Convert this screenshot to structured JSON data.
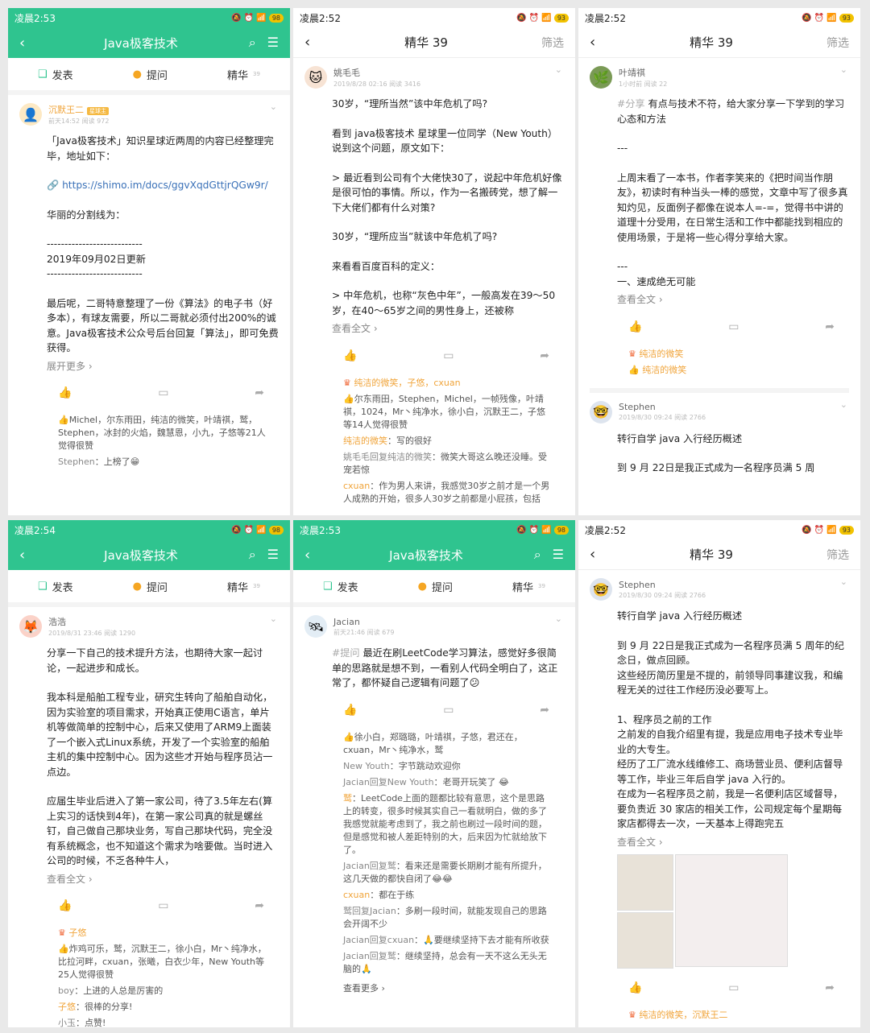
{
  "p1": {
    "time": "凌晨2:53",
    "battery": "98",
    "title": "Java极客技术",
    "tabs": [
      "发表",
      "提问",
      "精华"
    ],
    "tab_count": "39",
    "user": "沉默王二",
    "badge": "星球主",
    "meta": "前天14:52  阅读 972",
    "lines": [
      "「Java极客技术」知识星球近两周的内容已经整理完毕，地址如下：",
      "https://shimo.im/docs/ggvXqdGttjrQGw9r/",
      "华丽的分割线为：",
      "---------------------------\n2019年09月02日更新\n---------------------------",
      "最后呢，二哥特意整理了一份《算法》的电子书（好多本），有球友需要，所以二哥就必须付出200%的诚意。Java极客技术公众号后台回复「算法」，即可免费获得。"
    ],
    "more": "展开更多 ›",
    "likes": "Michel，尔东雨田，纯洁的微笑，叶靖祺，鹫，Stephen，冰封的火焰，魏慧恩，小九，子悠等21人觉得很赞",
    "comment_name": "Stephen",
    "comment_text": "上榜了😁"
  },
  "p2": {
    "time": "凌晨2:52",
    "battery": "93",
    "title": "精华 39",
    "filter": "筛选",
    "user": "姚毛毛",
    "meta": "2019/8/28 02:16  阅读 3416",
    "lines": [
      "30岁，“理所当然”该中年危机了吗?",
      "看到 java极客技术 星球里一位同学（New Youth）说到这个问题，原文如下：",
      "> 最近看到公司有个大佬快30了，说起中年危机好像是很可怕的事情。所以，作为一名搬砖党，想了解一下大佬们都有什么对策?",
      "30岁，“理所应当”就该中年危机了吗?",
      "来看看百度百科的定义：",
      "> 中年危机，也称“灰色中年”，一般高发在39～50岁，在40～65岁之间的男性身上，还被称"
    ],
    "more": "查看全文 ›",
    "reward": "纯洁的微笑，子悠，cxuan",
    "likes": "尔东雨田，Stephen，Michel，一帧残像，叶靖祺，1024，Mr丶纯净水，徐小白，沉默王二，子悠等14人觉得很赞",
    "comments": [
      {
        "name": "纯洁的微笑",
        "text": "：写的很好"
      },
      {
        "name": "姚毛毛回复纯洁的微笑",
        "text": "：微笑大哥这么晚还没睡。受宠若惊"
      },
      {
        "name": "cxuan",
        "text": "：作为男人来讲，我感觉30岁之前才是一个男人成熟的开始，很多人30岁之前都是小屁孩，包括"
      }
    ]
  },
  "p3": {
    "time": "凌晨2:52",
    "battery": "93",
    "title": "精华 39",
    "filter": "筛选",
    "user": "叶靖祺",
    "meta": "1小时前  阅读 22",
    "tag": "#分享",
    "first": "有点与技术不符，给大家分享一下学到的学习心态和方法",
    "lines": [
      "---",
      "上周末看了一本书，作者李笑来的《把时间当作朋友》，初读时有种当头一棒的感觉，文章中写了很多真知灼见，反面例子都像在说本人=-=，觉得书中讲的道理十分受用，在日常生活和工作中都能找到相应的使用场景，于是将一些心得分享给大家。",
      "---\n一、速成绝无可能"
    ],
    "more": "查看全文 ›",
    "reward": "纯洁的微笑",
    "likes": "纯洁的微笑",
    "user2": "Stephen",
    "meta2": "2019/8/30 09:24  阅读 2766",
    "line2": "转行自学 java 入行经历概述",
    "line3": "到 9 月 22日是我正式成为一名程序员满 5 周"
  },
  "p4": {
    "time": "凌晨2:54",
    "battery": "98",
    "title": "Java极客技术",
    "tabs": [
      "发表",
      "提问",
      "精华"
    ],
    "tab_count": "39",
    "user": "浩浩",
    "meta": "2019/8/31 23:46  阅读 1290",
    "lines": [
      "分享一下自己的技术提升方法，也期待大家一起讨论，一起进步和成长。",
      "我本科是船舶工程专业，研究生转向了船舶自动化，因为实验室的项目需求，开始真正使用C语言，单片机等做简单的控制中心，后来又使用了ARM9上面装了一个嵌入式Linux系统，开发了一个实验室的船舶主机的集中控制中心。因为这些才开始与程序员沾一点边。",
      "应届生毕业后进入了第一家公司，待了3.5年左右(算上实习的话快到4年)，在第一家公司真的就是螺丝钉，自己做自己那块业务，写自己那块代码，完全没有系统概念，也不知道这个需求为啥要做。当时进入公司的时候，不乏各种牛人，"
    ],
    "more": "查看全文 ›",
    "reward": "子悠",
    "likes": "炸鸡可乐，鹫，沉默王二，徐小白，Mr丶纯净水，比拉河畔，cxuan，张曦，白衣少年，New Youth等25人觉得很赞",
    "comments": [
      {
        "name": "boy",
        "text": "：上进的人总是厉害的"
      },
      {
        "name": "子悠",
        "text": "：很棒的分享!"
      },
      {
        "name": "小玉",
        "text": "：点赞!"
      }
    ]
  },
  "p5": {
    "time": "凌晨2:53",
    "battery": "98",
    "title": "Java极客技术",
    "tabs": [
      "发表",
      "提问",
      "精华"
    ],
    "tab_count": "39",
    "user": "Jacian",
    "meta": "前天21:46  阅读 679",
    "tag": "#提问",
    "first": "最近在刷LeetCode学习算法，感觉好多很简单的思路就是想不到，一看别人代码全明白了，这正常了，都怀疑自己逻辑有问题了😕",
    "likes": "徐小白，郑璐璐，叶靖祺，子悠，君还在，cxuan，Mr丶纯净水，鹫",
    "comments": [
      {
        "name": "New Youth",
        "text": "：字节跳动欢迎你"
      },
      {
        "name": "Jacian回复New Youth",
        "text": "：老哥开玩笑了 😂"
      },
      {
        "name": "鹫",
        "text": "：LeetCode上面的题都比较有意思，这个是思路上的转变，很多时候其实自己一看就明白，做的多了我感觉就能考虑到了，我之前也刷过一段时间的题，但是感觉和被人差距特别的大，后来因为忙就给放下了。"
      },
      {
        "name": "Jacian回复鹫",
        "text": "：看来还是需要长期刷才能有所提升，这几天做的都快自闭了😂😂"
      },
      {
        "name": "cxuan",
        "text": "：都在于练"
      },
      {
        "name": "鹫回复Jacian",
        "text": "：多刷一段时间，就能发现自己的思路会开阔不少"
      },
      {
        "name": "Jacian回复cxuan",
        "text": "：🙏要继续坚持下去才能有所收获"
      },
      {
        "name": "Jacian回复鹫",
        "text": "：继续坚持，总会有一天不这么无头无脑的🙏"
      }
    ],
    "more": "查看更多 ›"
  },
  "p6": {
    "time": "凌晨2:52",
    "battery": "93",
    "title": "精华 39",
    "filter": "筛选",
    "user": "Stephen",
    "meta": "2019/8/30 09:24  阅读 2766",
    "lines": [
      "转行自学 java 入行经历概述",
      "到 9 月 22日是我正式成为一名程序员满 5 周年的纪念日，做点回顾。\n这些经历简历里是不提的，前领导同事建议我，和编程无关的过往工作经历没必要写上。",
      "1、程序员之前的工作\n之前发的自我介绍里有提，我是应用电子技术专业毕业的大专生。\n经历了工厂流水线维修工、商场营业员、便利店督导等工作，毕业三年后自学 java 入行的。\n在成为一名程序员之前，我是一名便利店区域督导，要负责近 30 家店的相关工作，公司规定每个星期每家店都得去一次，一天基本上得跑完五"
    ],
    "more": "查看全文 ›",
    "reward": "纯洁的微笑，沉默王二"
  }
}
